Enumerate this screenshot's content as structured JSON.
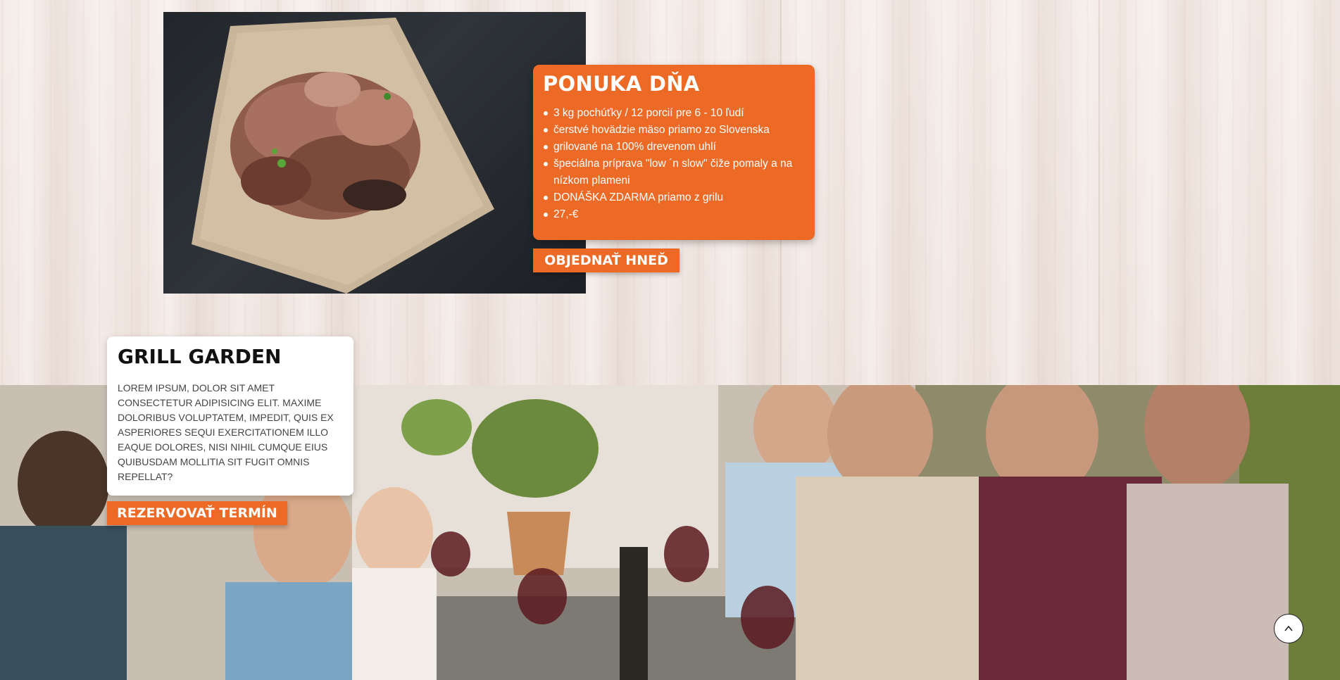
{
  "offer": {
    "title": "PONUKA DŇA",
    "items": [
      "3 kg pochúťky / 12 porcií pre 6 - 10 ľudí",
      "čerstvé hovädzie mäso priamo zo Slovenska",
      "grilované na 100% drevenom uhlí",
      "špeciálna príprava \"low ´n slow\" čiže pomaly a na nízkom plameni",
      "DONÁŠKA ZDARMA priamo z grilu",
      "27,-€"
    ],
    "order_label": "OBJEDNAŤ HNEĎ"
  },
  "garden": {
    "title": "GRILL GARDEN",
    "text": "Lorem ipsum, dolor sit amet consectetur adipisicing elit. Maxime doloribus voluptatem, impedit, quis ex asperiores sequi exercitationem illo eaque dolores, nisi nihil cumque eius quibusdam mollitia sit fugit omnis repellat?",
    "reserve_label": "REZERVOVAŤ TERMÍN"
  },
  "icons": {
    "scroll_top": "chevron-up-icon"
  },
  "colors": {
    "accent": "#ec6a25",
    "card_bg": "#ffffff",
    "wood_bg": "#f1e6e1"
  }
}
